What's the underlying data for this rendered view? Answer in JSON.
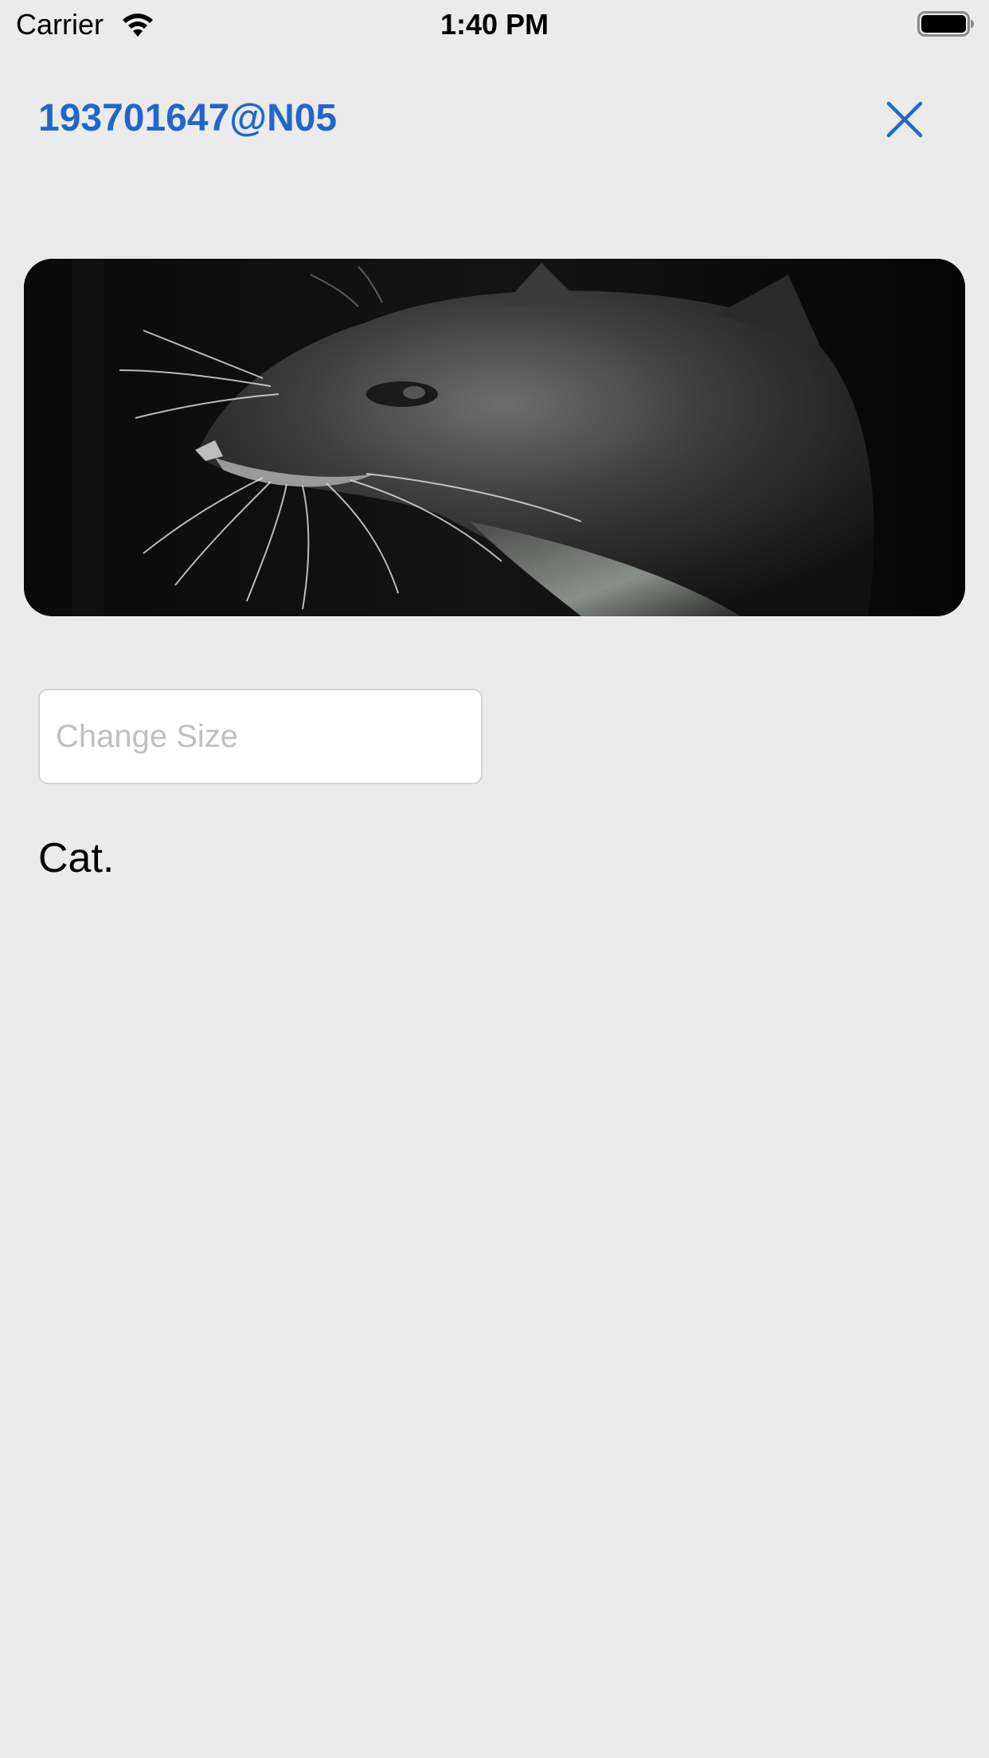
{
  "status_bar": {
    "carrier": "Carrier",
    "time": "1:40 PM",
    "wifi_icon": "wifi-icon",
    "battery_icon": "battery-icon"
  },
  "header": {
    "title": "193701647@N05",
    "close_icon": "close-icon",
    "accent_color": "#2266cc"
  },
  "photo": {
    "subject": "cat"
  },
  "size_input": {
    "value": "",
    "placeholder": "Change Size"
  },
  "caption": "Cat.",
  "colors": {
    "background": "#ebebeb",
    "input_border": "#d4d4d4",
    "placeholder": "#c0c0c0"
  }
}
